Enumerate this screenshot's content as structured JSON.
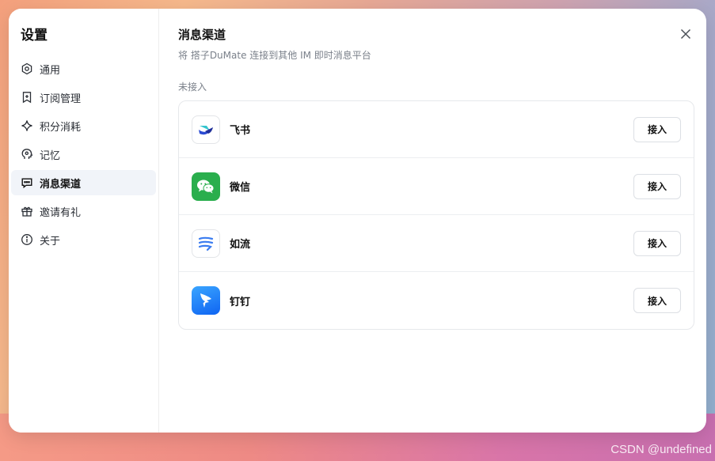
{
  "sidebar": {
    "title": "设置",
    "items": [
      {
        "label": "通用",
        "icon": "hexagon-gear-icon"
      },
      {
        "label": "订阅管理",
        "icon": "bookmark-plus-icon"
      },
      {
        "label": "积分消耗",
        "icon": "sparkle-icon"
      },
      {
        "label": "记忆",
        "icon": "brain-icon"
      },
      {
        "label": "消息渠道",
        "icon": "chat-bubble-icon",
        "active": true
      },
      {
        "label": "邀请有礼",
        "icon": "gift-icon"
      },
      {
        "label": "关于",
        "icon": "info-icon"
      }
    ]
  },
  "main": {
    "title": "消息渠道",
    "subtitle": "将 搭子DuMate 连接到其他 IM 即时消息平台",
    "section_label": "未接入",
    "channels": [
      {
        "name": "飞书",
        "icon": "feishu-logo-icon",
        "button": "接入"
      },
      {
        "name": "微信",
        "icon": "wechat-logo-icon",
        "button": "接入"
      },
      {
        "name": "如流",
        "icon": "ruliu-logo-icon",
        "button": "接入"
      },
      {
        "name": "钉钉",
        "icon": "dingtalk-logo-icon",
        "button": "接入"
      }
    ]
  },
  "watermark": "CSDN @undefined",
  "colors": {
    "wechat_green": "#2aae4d",
    "dingtalk_blue": "#1677ff",
    "active_bg": "#f1f4f9"
  }
}
